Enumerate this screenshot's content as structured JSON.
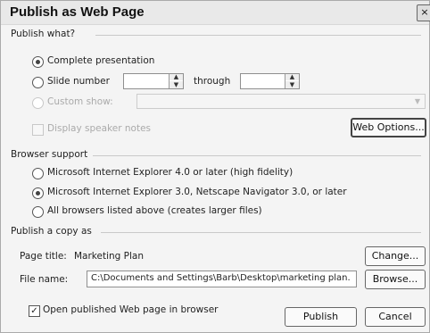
{
  "dialog": {
    "title": "Publish as Web Page",
    "close_label": "×"
  },
  "publish_what": {
    "label": "Publish what?",
    "complete_presentation": "Complete presentation",
    "slide_number": "Slide number",
    "through": "through",
    "custom_show": "Custom show:",
    "display_speaker_notes": "Display speaker notes",
    "web_options_button": "Web Options..."
  },
  "browser_support": {
    "label": "Browser support",
    "options": [
      "Microsoft Internet Explorer 4.0 or later (high fidelity)",
      "Microsoft Internet Explorer 3.0, Netscape Navigator 3.0, or later",
      "All browsers listed above (creates larger files)"
    ],
    "selected_index": 1
  },
  "publish_copy": {
    "label": "Publish a copy as",
    "page_title_label": "Page title:",
    "page_title_value": "Marketing Plan",
    "change_button": "Change...",
    "file_name_label": "File name:",
    "file_name_value": "C:\\Documents and Settings\\Barb\\Desktop\\marketing plan.",
    "browse_button": "Browse..."
  },
  "footer": {
    "open_in_browser": "Open published Web page in browser",
    "open_in_browser_checked": true,
    "publish_button": "Publish",
    "cancel_button": "Cancel"
  }
}
